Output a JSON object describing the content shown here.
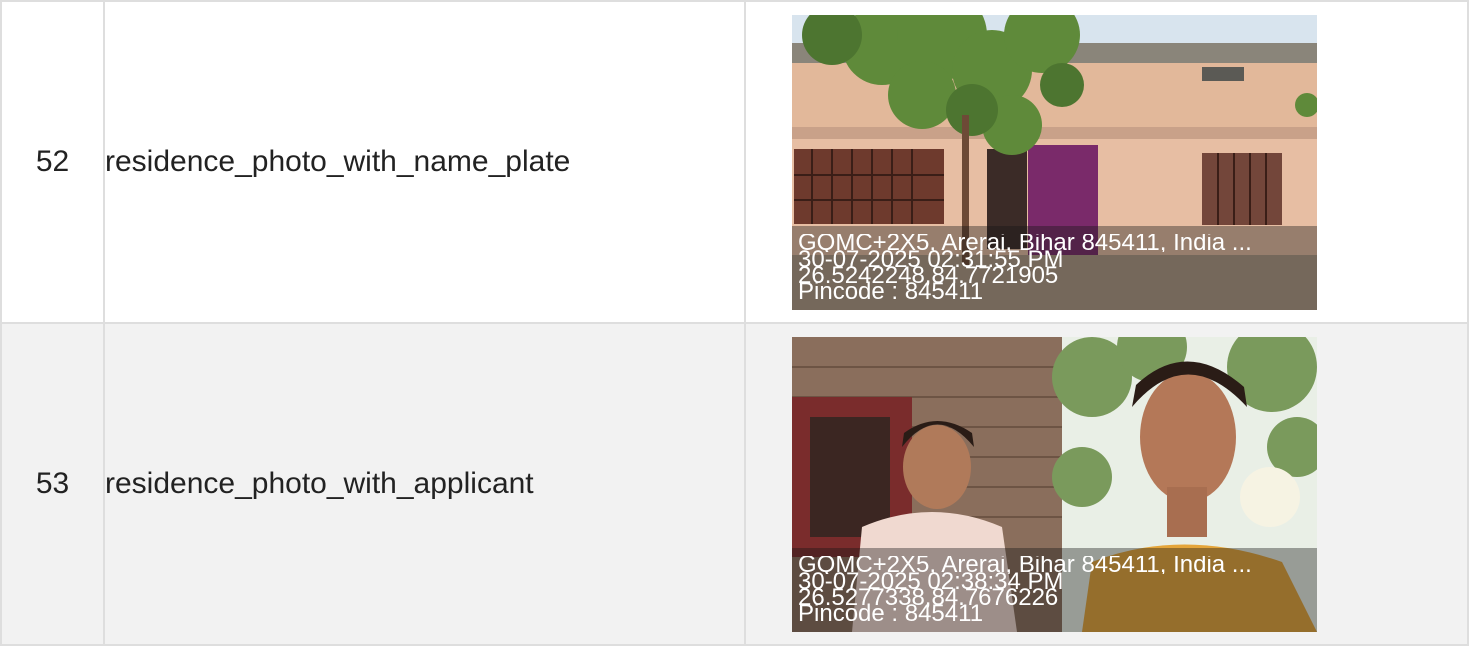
{
  "rows": [
    {
      "number": "52",
      "field": "residence_photo_with_name_plate",
      "photo": {
        "icon": "house-photo",
        "address": "GQMC+2X5, Arerai, Bihar 845411, India ...",
        "datetime": "30-07-2025 02:31:55 PM",
        "coordinates": "26.5242248,84.7721905",
        "pincode": "Pincode : 845411"
      }
    },
    {
      "number": "53",
      "field": "residence_photo_with_applicant",
      "photo": {
        "icon": "selfie-photo",
        "address": "GQMC+2X5, Arerai, Bihar 845411, India ...",
        "datetime": "30-07-2025 02:38:34 PM",
        "coordinates": "26.5277338,84.7676226",
        "pincode": "Pincode : 845411"
      }
    }
  ],
  "colors": {
    "border": "#dedede",
    "row_alt": "#f2f2f2",
    "text": "#222222",
    "overlay_text": "#ffffff"
  }
}
